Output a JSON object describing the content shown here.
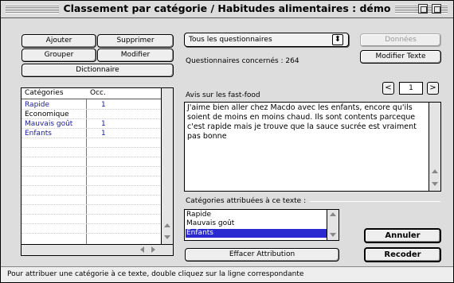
{
  "window": {
    "title": "Classement par catégorie / Habitudes alimentaires : démo"
  },
  "toolbar": {
    "ajouter": "Ajouter",
    "supprimer": "Supprimer",
    "grouper": "Grouper",
    "modifier": "Modifier",
    "dictionnaire": "Dictionnaire"
  },
  "categories_table": {
    "headers": [
      "Catégories",
      "Occ."
    ],
    "rows": [
      {
        "name": "Rapide",
        "occ": "1"
      },
      {
        "name": "Economique",
        "occ": ""
      },
      {
        "name": "Mauvais goût",
        "occ": "1"
      },
      {
        "name": "Enfants",
        "occ": "1"
      }
    ]
  },
  "questionnaire": {
    "selected": "Tous les questionnaires",
    "count_text": "Questionnaires concernés : 264",
    "donnees_label": "Données",
    "modifier_texte_label": "Modifier Texte"
  },
  "question": {
    "label": "Avis sur les fast-food",
    "page_number": "1",
    "prev_glyph": "<",
    "next_glyph": ">",
    "answer_text": "J'aime bien aller chez Macdo avec les enfants, encore qu'ils soient de moins en moins chaud. Ils sont contents parceque c'est rapide mais je trouve que la sauce sucrée est vraiment pas bonne"
  },
  "attributed": {
    "label": "Catégories attribuées à ce texte :",
    "items": [
      "Rapide",
      "Mauvais goût",
      "Enfants"
    ],
    "selected_index": 2
  },
  "actions": {
    "annuler": "Annuler",
    "recoder": "Recoder",
    "effacer": "Effacer Attribution"
  },
  "status": {
    "text": "Pour attribuer une catégorie à ce texte, double cliquez sur la ligne correspondante"
  },
  "colors": {
    "selection": "#2a2ad0",
    "category_text": "#1a1a9a"
  }
}
